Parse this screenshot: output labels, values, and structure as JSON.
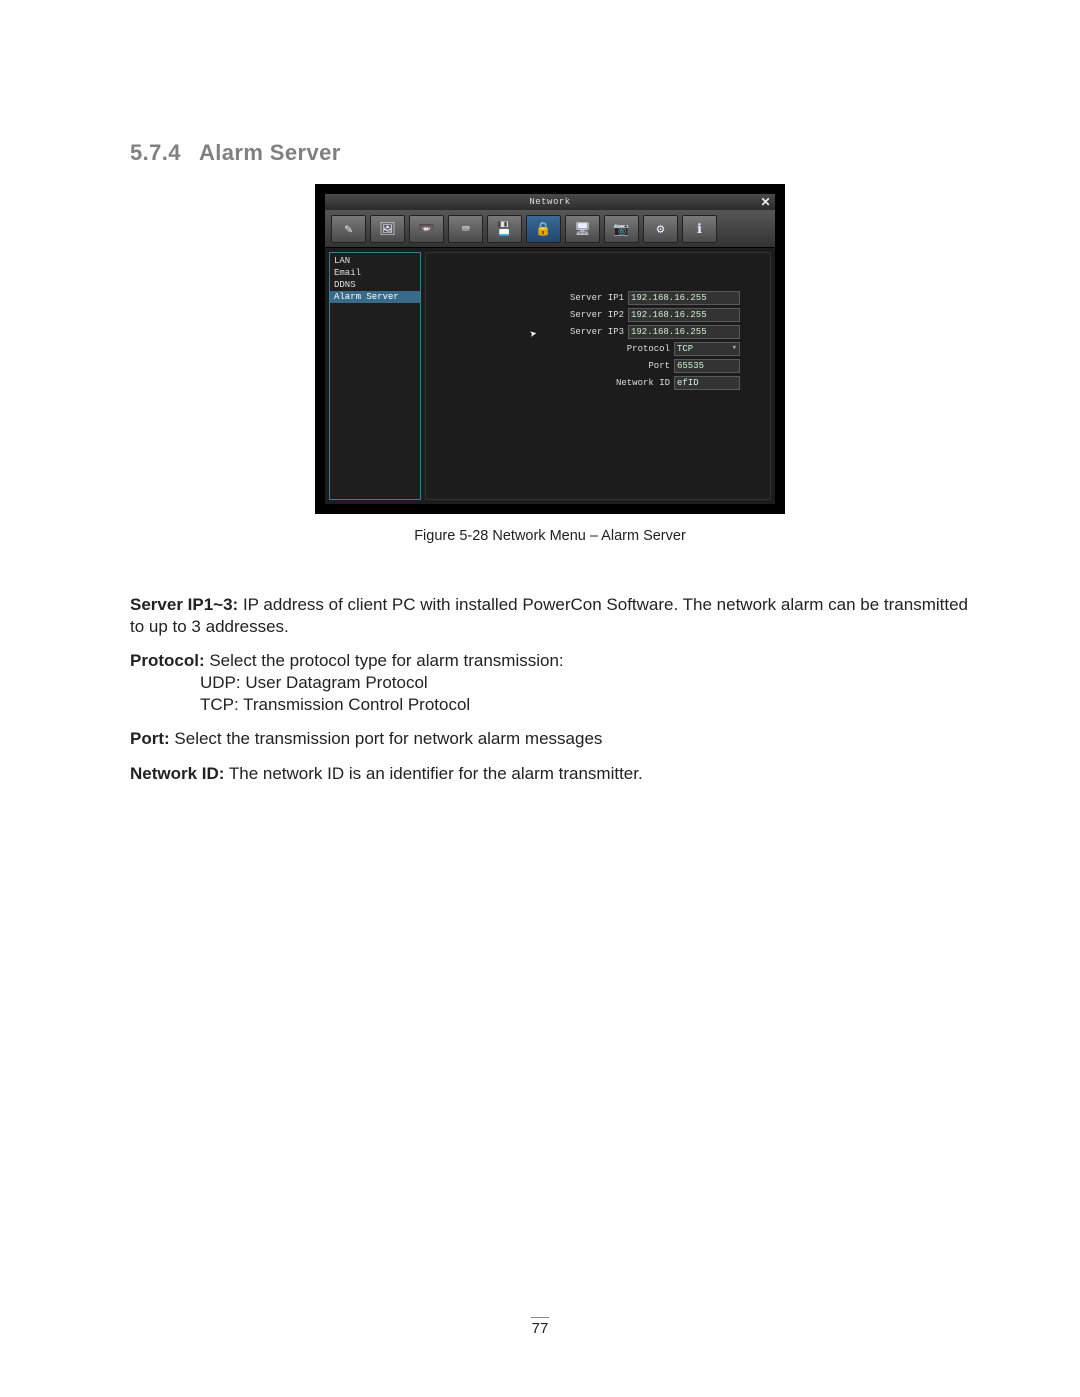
{
  "heading": {
    "num": "5.7.4",
    "title": "Alarm Server"
  },
  "screenshot": {
    "window_title": "Network",
    "close_glyph": "✕",
    "toolbar_glyphs": [
      "✎",
      "🖼",
      "📼",
      "⌨",
      "💾",
      "🔒",
      "🖥",
      "📷",
      "⚙",
      "ℹ"
    ],
    "toolbar_selected_index": 5,
    "sidebar": {
      "items": [
        "LAN",
        "Email",
        "DDNS",
        "Alarm Server"
      ],
      "selected_index": 3
    },
    "form": {
      "fields": [
        {
          "label": "Server IP1",
          "value": "192.168.16.255"
        },
        {
          "label": "Server IP2",
          "value": "192.168.16.255"
        },
        {
          "label": "Server IP3",
          "value": "192.168.16.255"
        }
      ],
      "protocol_label": "Protocol",
      "protocol_value": "TCP",
      "port_label": "Port",
      "port_value": "65535",
      "netid_label": "Network ID",
      "netid_value": "efID"
    }
  },
  "figure_caption": "Figure 5-28  Network Menu – Alarm Server",
  "body": {
    "server_ip_bold": "Server IP1~3:",
    "server_ip_text": " IP address of client PC with installed PowerCon Software. The network alarm can be transmitted to up to 3 addresses.",
    "protocol_bold": "Protocol:",
    "protocol_text": " Select the protocol type for alarm transmission:",
    "protocol_line1": "UDP: User Datagram Protocol",
    "protocol_line2": "TCP: Transmission Control Protocol",
    "port_bold": "Port:",
    "port_text": " Select the transmission port for network alarm messages",
    "netid_bold": "Network ID:",
    "netid_text": " The network ID is an identifier for the alarm transmitter."
  },
  "page_number": "77"
}
